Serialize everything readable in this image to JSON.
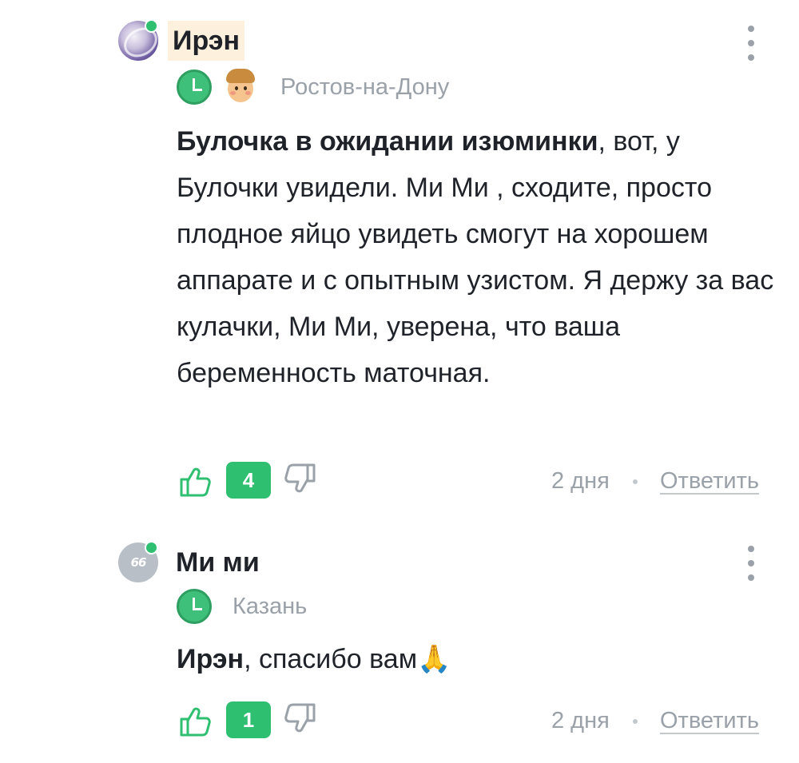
{
  "comments": [
    {
      "author": "Ирэн",
      "city": "Ростов-на-Дону",
      "mention": "Булочка в ожидании изюминки",
      "text": ", вот, у Булочки увидели. Ми Ми , сходите, просто плодное яйцо увидеть смогут на хорошем аппарате и с опытным узистом. Я держу за вас кулачки, Ми Ми, уверена, что ваша беременность маточная.",
      "likes": "4",
      "time": "2 дня",
      "reply_label": "Ответить",
      "icons": [
        "avatar",
        "online-dot",
        "more-vert-icon",
        "clock-badge-icon",
        "kid-badge-icon",
        "thumbs-up-icon",
        "thumbs-down-icon"
      ]
    },
    {
      "author": "Ми ми",
      "city": "Казань",
      "mention": "Ирэн",
      "text": ", спасибо вам🙏",
      "likes": "1",
      "time": "2 дня",
      "reply_label": "Ответить",
      "icons": [
        "avatar-quote-icon",
        "online-dot",
        "more-vert-icon",
        "clock-badge-icon",
        "thumbs-up-icon",
        "thumbs-down-icon"
      ]
    }
  ],
  "colors": {
    "accent_green": "#2fbf71",
    "muted_text": "#9aa1a9",
    "primary_text": "#1f2329",
    "author_highlight": "#fdf1dd"
  }
}
